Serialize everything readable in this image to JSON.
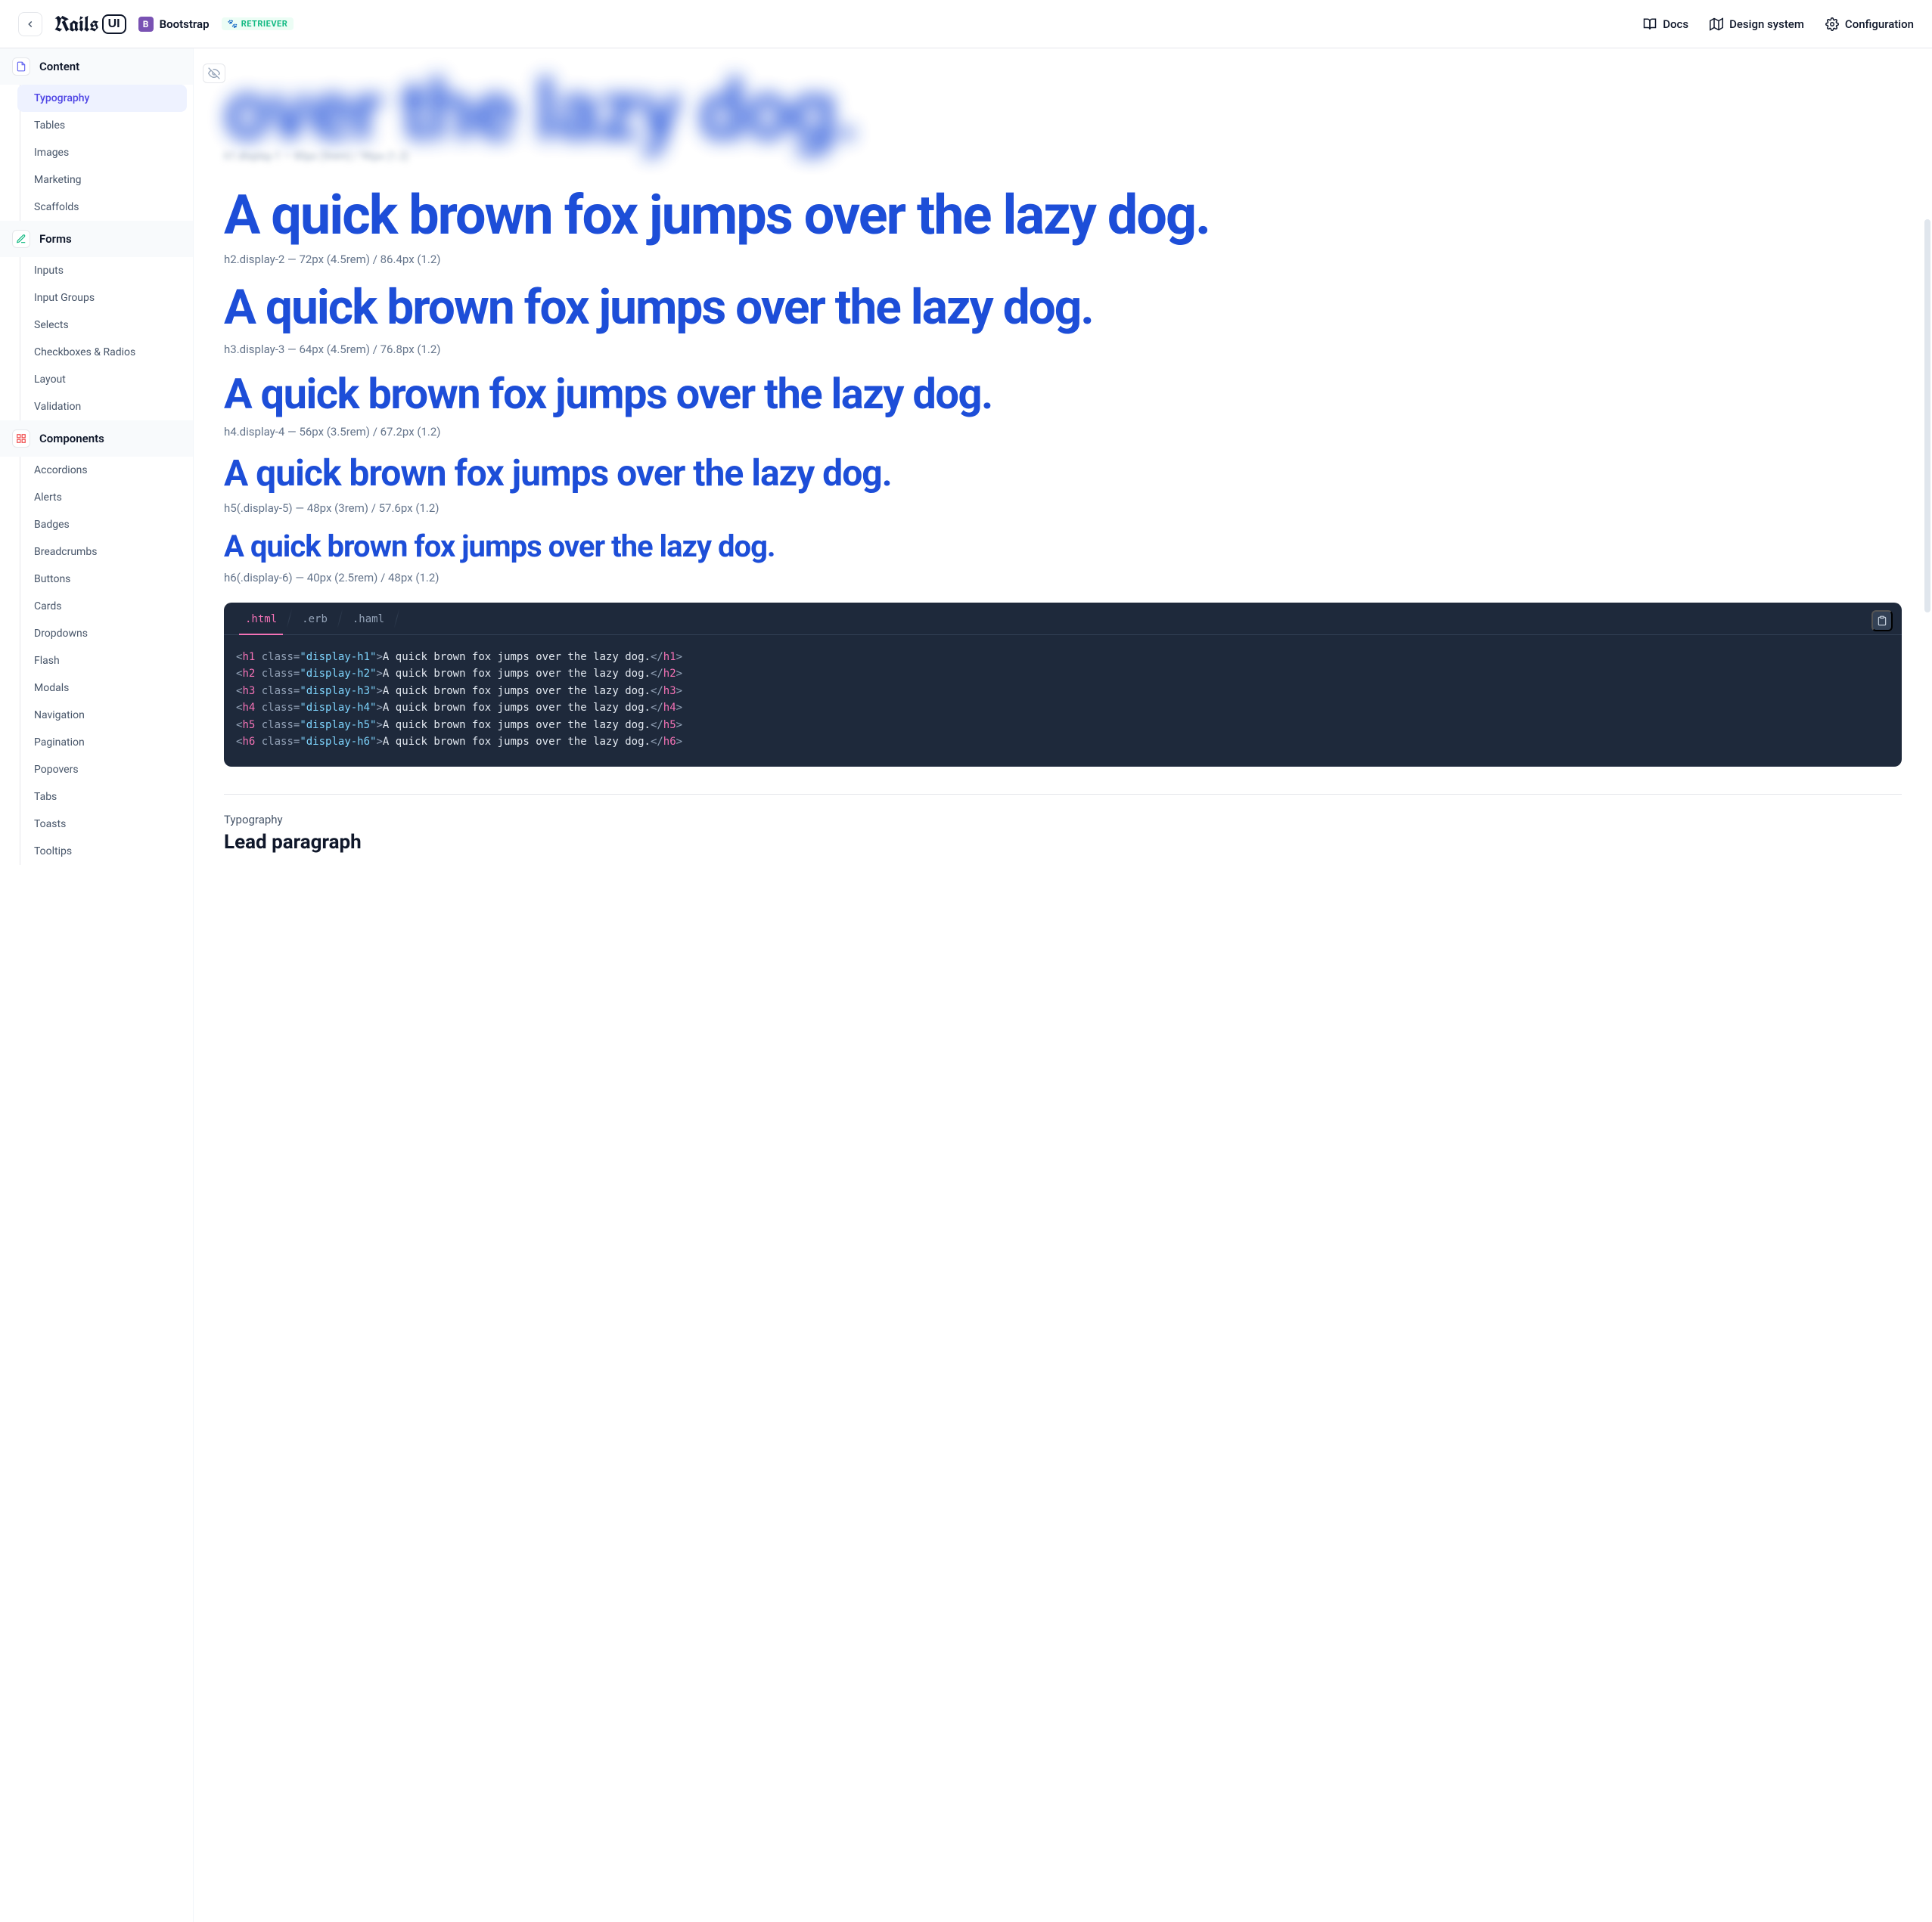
{
  "header": {
    "logo_main": "Rails",
    "logo_ui": "UI",
    "bootstrap": "Bootstrap",
    "retriever": "RETRIEVER",
    "nav": {
      "docs": "Docs",
      "design": "Design system",
      "config": "Configuration"
    }
  },
  "sidebar": {
    "content": {
      "label": "Content",
      "items": [
        "Typography",
        "Tables",
        "Images",
        "Marketing",
        "Scaffolds"
      ]
    },
    "forms": {
      "label": "Forms",
      "items": [
        "Inputs",
        "Input Groups",
        "Selects",
        "Checkboxes & Radios",
        "Layout",
        "Validation"
      ]
    },
    "components": {
      "label": "Components",
      "items": [
        "Accordions",
        "Alerts",
        "Badges",
        "Breadcrumbs",
        "Buttons",
        "Cards",
        "Dropdowns",
        "Flash",
        "Modals",
        "Navigation",
        "Pagination",
        "Popovers",
        "Tabs",
        "Toasts",
        "Tooltips"
      ]
    }
  },
  "main": {
    "blur_heading": "over the lazy dog.",
    "blur_caption": "h1.display-1 — 80px (5rem) / 96px (1.2)",
    "sample": "A quick brown fox jumps over the lazy dog.",
    "captions": {
      "d2": "h2.display-2 — 72px (4.5rem) / 86.4px (1.2)",
      "d3": "h3.display-3 — 64px (4.5rem) / 76.8px (1.2)",
      "d4": "h4.display-4 — 56px (3.5rem) / 67.2px (1.2)",
      "d5": "h5(.display-5) — 48px (3rem) / 57.6px (1.2)",
      "d6": "h6(.display-6) — 40px (2.5rem) / 48px (1.2)"
    },
    "code": {
      "tabs": {
        "html": ".html",
        "erb": ".erb",
        "haml": ".haml"
      },
      "lines": [
        {
          "tag": "h1",
          "cls": "display-h1",
          "text": "A quick brown fox jumps over the lazy dog."
        },
        {
          "tag": "h2",
          "cls": "display-h2",
          "text": "A quick brown fox jumps over the lazy dog."
        },
        {
          "tag": "h3",
          "cls": "display-h3",
          "text": "A quick brown fox jumps over the lazy dog."
        },
        {
          "tag": "h4",
          "cls": "display-h4",
          "text": "A quick brown fox jumps over the lazy dog."
        },
        {
          "tag": "h5",
          "cls": "display-h5",
          "text": "A quick brown fox jumps over the lazy dog."
        },
        {
          "tag": "h6",
          "cls": "display-h6",
          "text": "A quick brown fox jumps over the lazy dog."
        }
      ]
    },
    "footer": {
      "label": "Typography",
      "title": "Lead paragraph"
    }
  }
}
